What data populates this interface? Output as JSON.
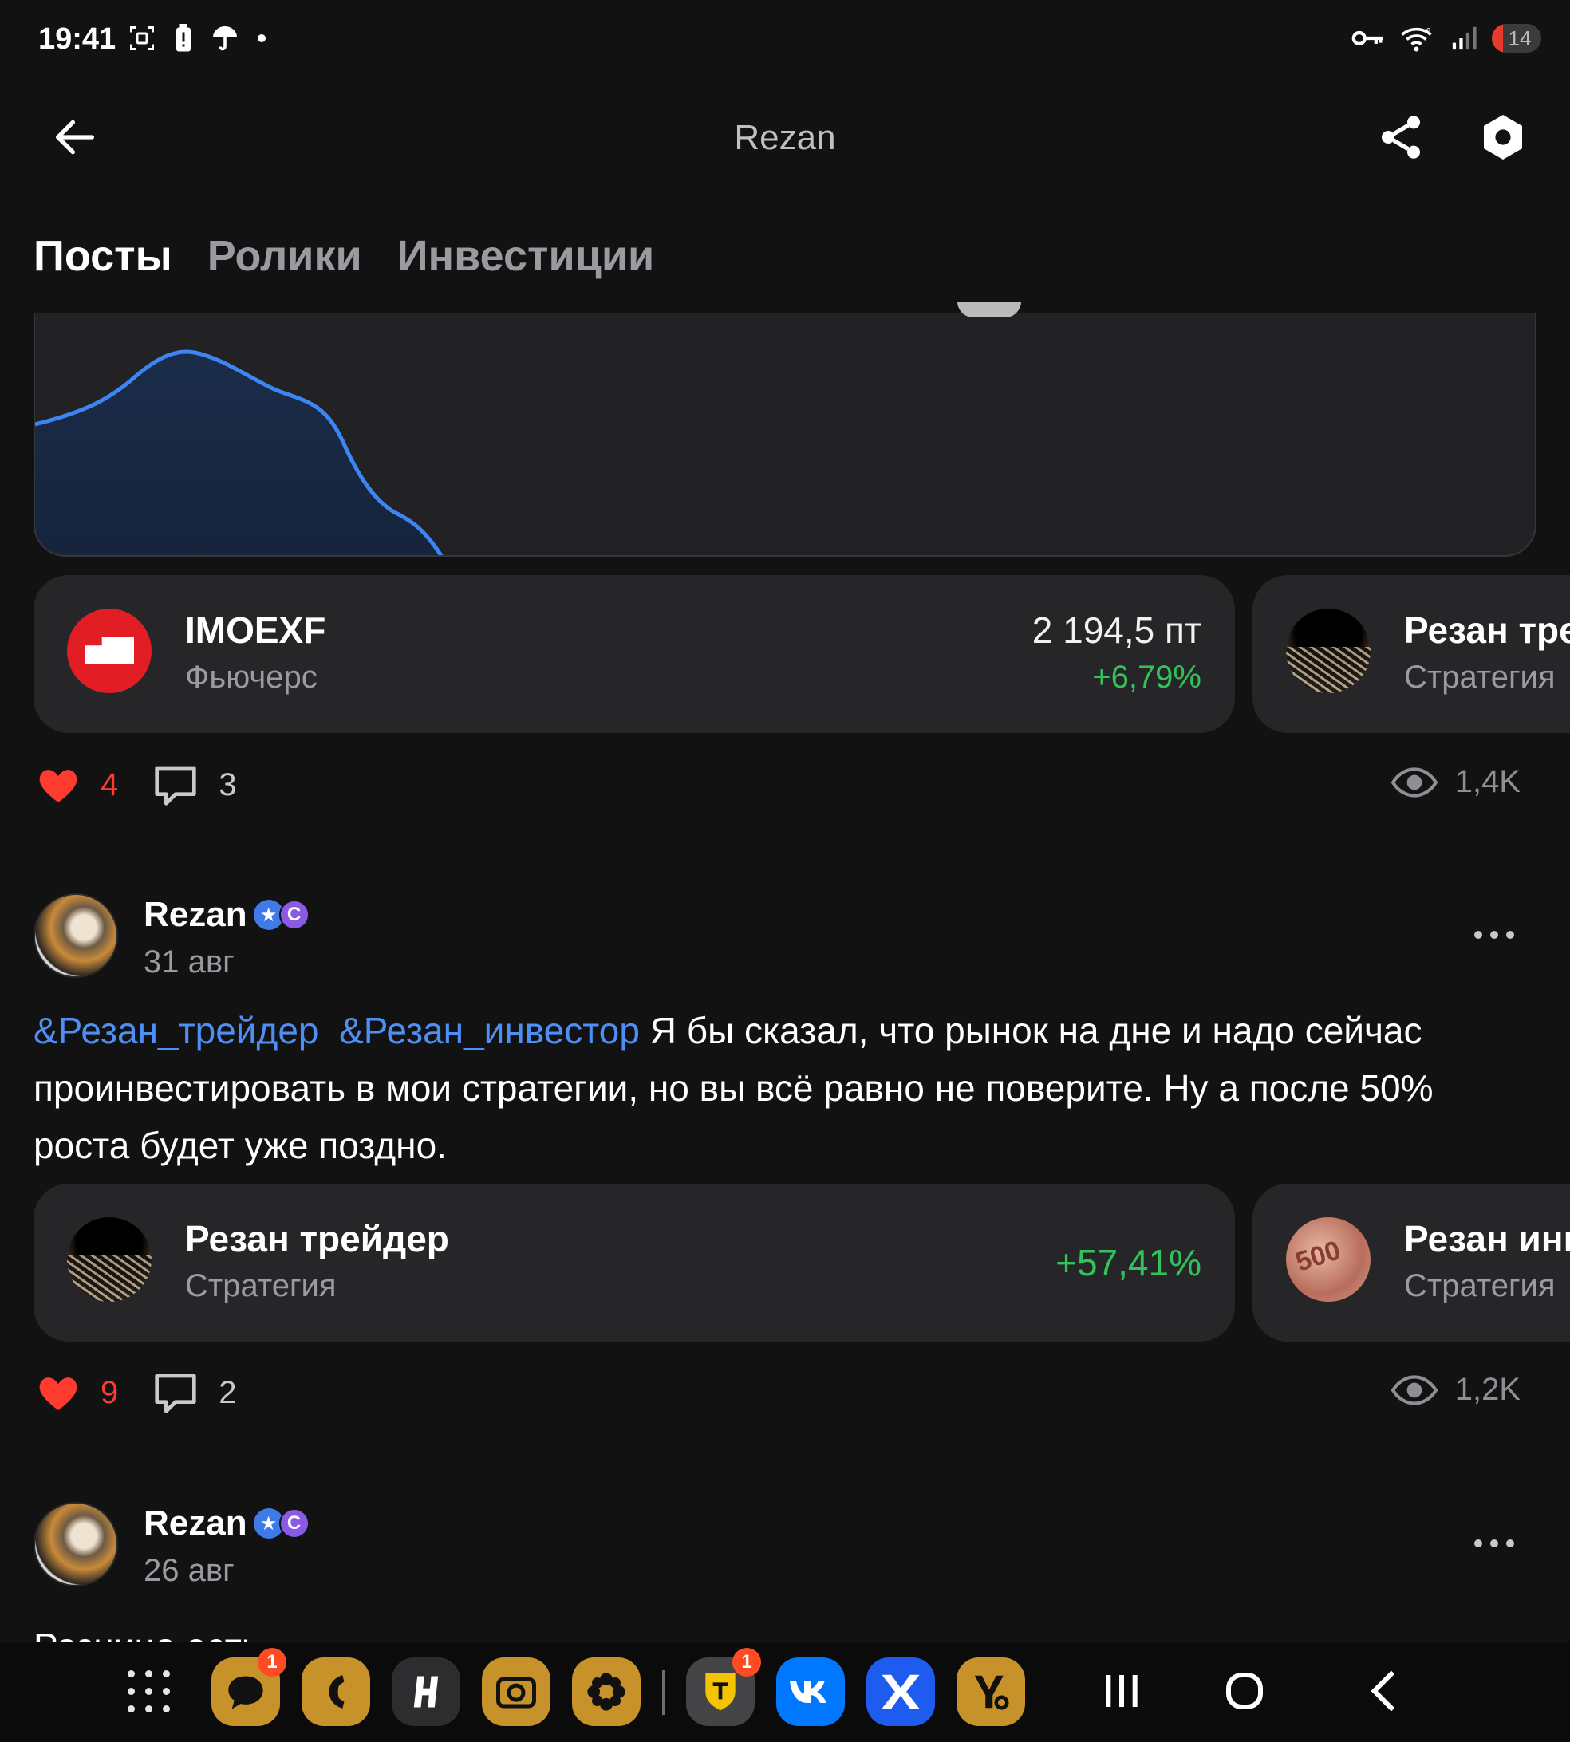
{
  "status_bar": {
    "time": "19:41",
    "left_icons": [
      "screenshot-icon",
      "battery-alert-icon",
      "umbrella-icon",
      "dot-icon"
    ],
    "right_icons": [
      "key-icon",
      "wifi-icon",
      "signal-icon"
    ],
    "battery_level": "14"
  },
  "header": {
    "title": "Rezan",
    "back_icon": "arrow-left-icon",
    "share_icon": "share-icon",
    "settings_icon": "settings-icon"
  },
  "tabs": [
    {
      "label": "Посты",
      "active": true
    },
    {
      "label": "Ролики",
      "active": false
    },
    {
      "label": "Инвестиции",
      "active": false
    }
  ],
  "post1": {
    "instrument_card": {
      "name": "IMOEXF",
      "type": "Фьючерс",
      "price": "2 194,5 пт",
      "change": "+6,79%"
    },
    "strategy_card": {
      "name": "Резан тре",
      "type": "Стратегия"
    },
    "likes": "4",
    "comments": "3",
    "views": "1,4K"
  },
  "post2": {
    "author": "Rezan",
    "date": "31 авг",
    "tag1": "&Резан_трейдер",
    "tag2": "&Резан_инвестор",
    "text": " Я бы сказал, что рынок на дне и надо сейчас проинвестировать в мои стратегии, но вы всё равно не поверите. Ну а после 50% роста будет уже поздно.",
    "strategy_card1": {
      "name": "Резан трейдер",
      "type": "Стратегия",
      "change": "+57,41%"
    },
    "strategy_card2": {
      "name": "Резан инв",
      "type": "Стратегия"
    },
    "likes": "9",
    "comments": "2",
    "views": "1,2K"
  },
  "post3": {
    "author": "Rezan",
    "date": "26 авг",
    "text_preview": "Разница есть"
  },
  "dock": {
    "apps": [
      {
        "name": "messages-app-icon",
        "badge": "1"
      },
      {
        "name": "phone-app-icon",
        "badge": ""
      },
      {
        "name": "h-app-icon",
        "badge": ""
      },
      {
        "name": "camera-app-icon",
        "badge": ""
      },
      {
        "name": "flower-app-icon",
        "badge": ""
      },
      {
        "name": "tbank-app-icon",
        "badge": "1"
      },
      {
        "name": "vk-app-icon",
        "badge": ""
      },
      {
        "name": "x-app-icon",
        "badge": ""
      },
      {
        "name": "yo-app-icon",
        "badge": ""
      }
    ]
  },
  "colors": {
    "background": "#121213",
    "card": "#262628",
    "accent_link": "#4d8ff5",
    "positive": "#33c15a",
    "like": "#ff3b30"
  }
}
